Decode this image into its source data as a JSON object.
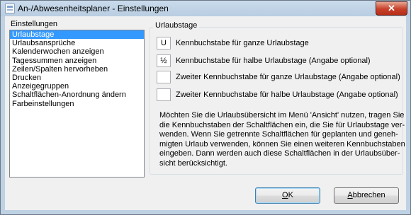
{
  "window": {
    "title": "An-/Abwesenheitsplaner - Einstellungen",
    "close_glyph": "✕"
  },
  "settings": {
    "label": "Einstellungen",
    "items": [
      "Urlaubstage",
      "Urlaubsansprüche",
      "Kalenderwochen anzeigen",
      "Tagessummen anzeigen",
      "Zeilen/Spalten hervorheben",
      "Drucken",
      "Anzeigegruppen",
      "Schaltflächen-Anordnung ändern",
      "Farbeinstellungen"
    ],
    "selected_index": 0
  },
  "vacation": {
    "group_title": "Urlaubstage",
    "options": [
      {
        "value": "U",
        "label": "Kennbuchstabe für ganze Urlaubstage"
      },
      {
        "value": "½",
        "label": "Kennbuchstabe für halbe Urlaubstage (Angabe optional)"
      },
      {
        "value": "",
        "label": "Zweiter Kennbuchstabe für ganze Urlaubstage (Angabe optional)"
      },
      {
        "value": "",
        "label": "Zweiter Kennbuchstabe für halbe Urlaubstage (Angabe optional)"
      }
    ],
    "info_lines": [
      "Möchten Sie die Urlaubsübersicht im Menü 'Ansicht' nutzen, tragen Sie",
      "die Kennbuchstaben der Schaltflächen ein, die Sie für Urlaubstage ver-",
      "wenden. Wenn Sie getrennte Schaltflächen für geplanten und geneh-",
      "migten Urlaub verwenden, können Sie einen weiteren Kennbuchstaben",
      "eingeben. Dann werden auch diese Schaltflächen in der Urlaubsüber-",
      "sicht berücksichtigt."
    ]
  },
  "buttons": {
    "ok": {
      "mnemonic": "O",
      "rest": "K"
    },
    "cancel": {
      "mnemonic": "A",
      "rest": "bbrechen"
    }
  }
}
